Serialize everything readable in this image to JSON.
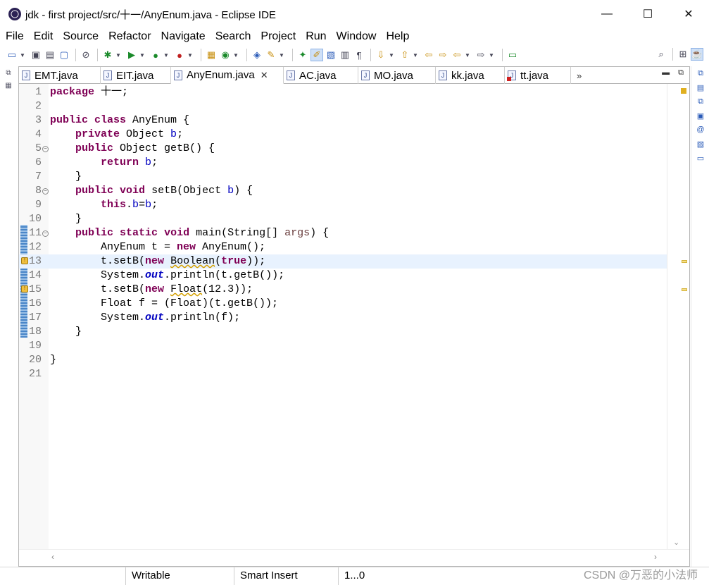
{
  "window": {
    "title": "jdk - first project/src/十一/AnyEnum.java - Eclipse IDE",
    "minimize": "—",
    "maximize": "☐",
    "close": "✕"
  },
  "menu": [
    "File",
    "Edit",
    "Source",
    "Refactor",
    "Navigate",
    "Search",
    "Project",
    "Run",
    "Window",
    "Help"
  ],
  "tabs": [
    {
      "label": "EMT.java",
      "error": false,
      "active": false
    },
    {
      "label": "EIT.java",
      "error": false,
      "active": false
    },
    {
      "label": "AnyEnum.java",
      "error": false,
      "active": true
    },
    {
      "label": "AC.java",
      "error": false,
      "active": false
    },
    {
      "label": "MO.java",
      "error": false,
      "active": false
    },
    {
      "label": "kk.java",
      "error": false,
      "active": false
    },
    {
      "label": "tt.java",
      "error": true,
      "active": false
    }
  ],
  "tab_overflow": "»",
  "editor": {
    "lines": [
      {
        "n": "1",
        "text": "package 十一;"
      },
      {
        "n": "2",
        "text": ""
      },
      {
        "n": "3",
        "text": "public class AnyEnum {"
      },
      {
        "n": "4",
        "text": "    private Object b;"
      },
      {
        "n": "5",
        "text": "    public Object getB() {"
      },
      {
        "n": "6",
        "text": "        return b;"
      },
      {
        "n": "7",
        "text": "    }"
      },
      {
        "n": "8",
        "text": "    public void setB(Object b) {"
      },
      {
        "n": "9",
        "text": "        this.b=b;"
      },
      {
        "n": "10",
        "text": "    }"
      },
      {
        "n": "11",
        "text": "    public static void main(String[] args) {"
      },
      {
        "n": "12",
        "text": "        AnyEnum t = new AnyEnum();"
      },
      {
        "n": "13",
        "text": "        t.setB(new Boolean(true));"
      },
      {
        "n": "14",
        "text": "        System.out.println(t.getB());"
      },
      {
        "n": "15",
        "text": "        t.setB(new Float(12.3));"
      },
      {
        "n": "16",
        "text": "        Float f = (Float)(t.getB());"
      },
      {
        "n": "17",
        "text": "        System.out.println(f);"
      },
      {
        "n": "18",
        "text": "    }"
      },
      {
        "n": "19",
        "text": ""
      },
      {
        "n": "20",
        "text": "}"
      },
      {
        "n": "21",
        "text": ""
      }
    ],
    "current_line": 13,
    "warning_lines": [
      13,
      15
    ],
    "fold_lines": [
      5,
      8,
      11
    ]
  },
  "status": {
    "writable": "Writable",
    "insert_mode": "Smart Insert",
    "position": "1...0"
  },
  "watermark": "CSDN @万恶的小法师",
  "colors": {
    "keyword": "#7f0055",
    "field": "#0000c0",
    "current_line": "#e8f2fe",
    "warning": "#f0c040"
  }
}
